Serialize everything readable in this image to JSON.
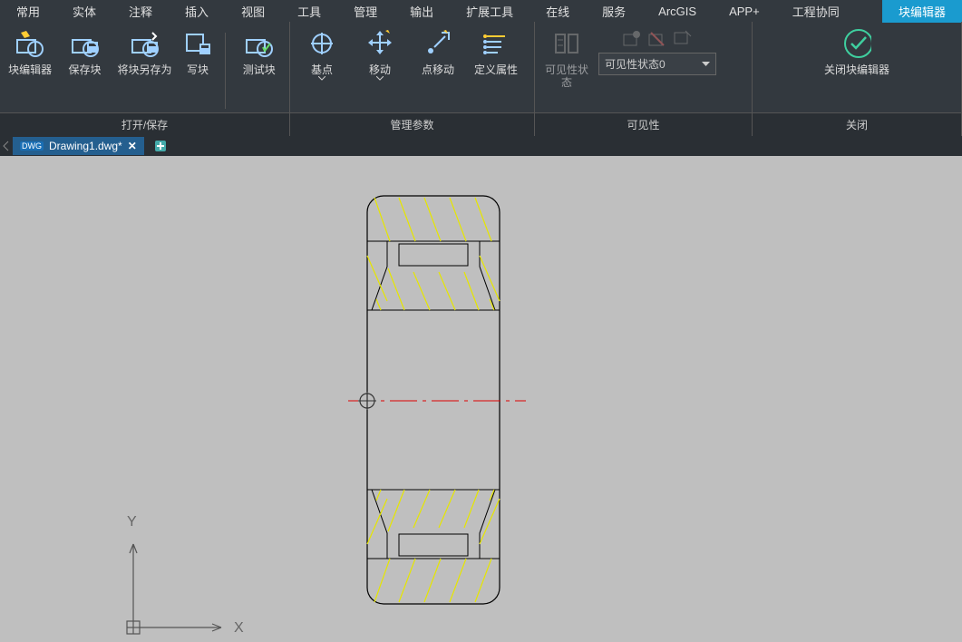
{
  "main_tabs": {
    "items": [
      "常用",
      "实体",
      "注释",
      "插入",
      "视图",
      "工具",
      "管理",
      "输出",
      "扩展工具",
      "在线",
      "服务",
      "ArcGIS",
      "APP+",
      "工程协同",
      "块编辑器"
    ],
    "active_index": 14
  },
  "ribbon": {
    "panels": {
      "open_save": {
        "title": "打开/保存",
        "buttons": {
          "block_editor": "块编辑器",
          "save_block": "保存块",
          "save_block_as": "将块另存为",
          "write_block": "写块",
          "test_block": "测试块"
        }
      },
      "manage_params": {
        "title": "管理参数",
        "buttons": {
          "base_point": "基点",
          "move": "移动",
          "point_move": "点移动",
          "define_attr": "定义属性"
        }
      },
      "visibility": {
        "title": "可见性",
        "buttons": {
          "vis_state": "可见性状态"
        },
        "combo_value": "可见性状态0"
      },
      "close": {
        "title": "关闭",
        "buttons": {
          "close_editor": "关闭块编辑器"
        }
      }
    }
  },
  "file_tabs": {
    "items": [
      {
        "name": "Drawing1.dwg*"
      }
    ]
  },
  "ucs": {
    "x_label": "X",
    "y_label": "Y"
  }
}
